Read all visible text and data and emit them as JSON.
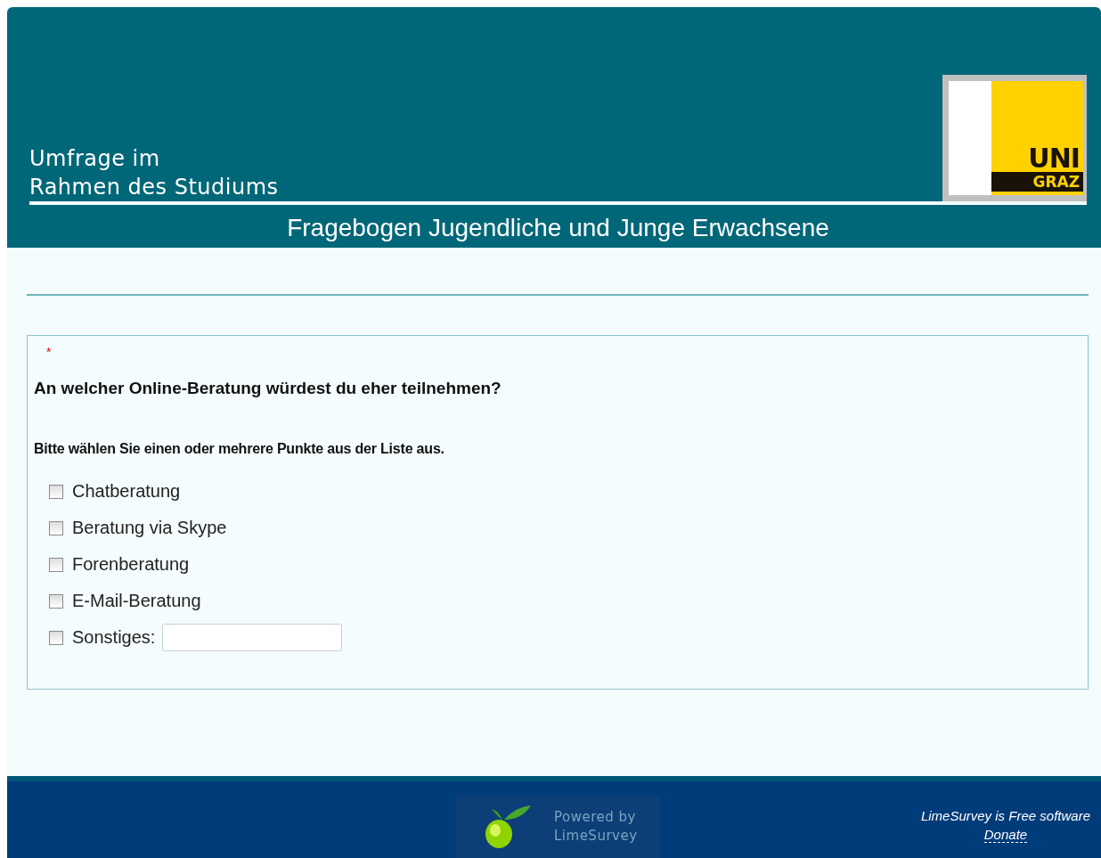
{
  "header": {
    "survey_title_lines": [
      "Umfrage im",
      "Rahmen des Studiums"
    ],
    "logo": {
      "top": "UNI",
      "bottom": "GRAZ"
    },
    "subtitle": "Fragebogen Jugendliche und Junge Erwachsene"
  },
  "question": {
    "mandatory_mark": "*",
    "text": "An welcher Online-Beratung würdest du eher teilnehmen?",
    "help": "Bitte wählen Sie einen oder mehrere Punkte aus der Liste aus.",
    "options": [
      {
        "kind": "checkbox",
        "label": "Chatberatung",
        "checked": false
      },
      {
        "kind": "checkbox",
        "label": "Beratung via Skype",
        "checked": false
      },
      {
        "kind": "checkbox",
        "label": "Forenberatung",
        "checked": false
      },
      {
        "kind": "checkbox",
        "label": "E-Mail-Beratung",
        "checked": false
      },
      {
        "kind": "other",
        "label": "Sonstiges:",
        "checked": false
      }
    ]
  },
  "footer": {
    "powered_by": [
      "Powered by",
      "LimeSurvey"
    ],
    "free_software": "LimeSurvey is Free software",
    "donate": "Donate"
  }
}
